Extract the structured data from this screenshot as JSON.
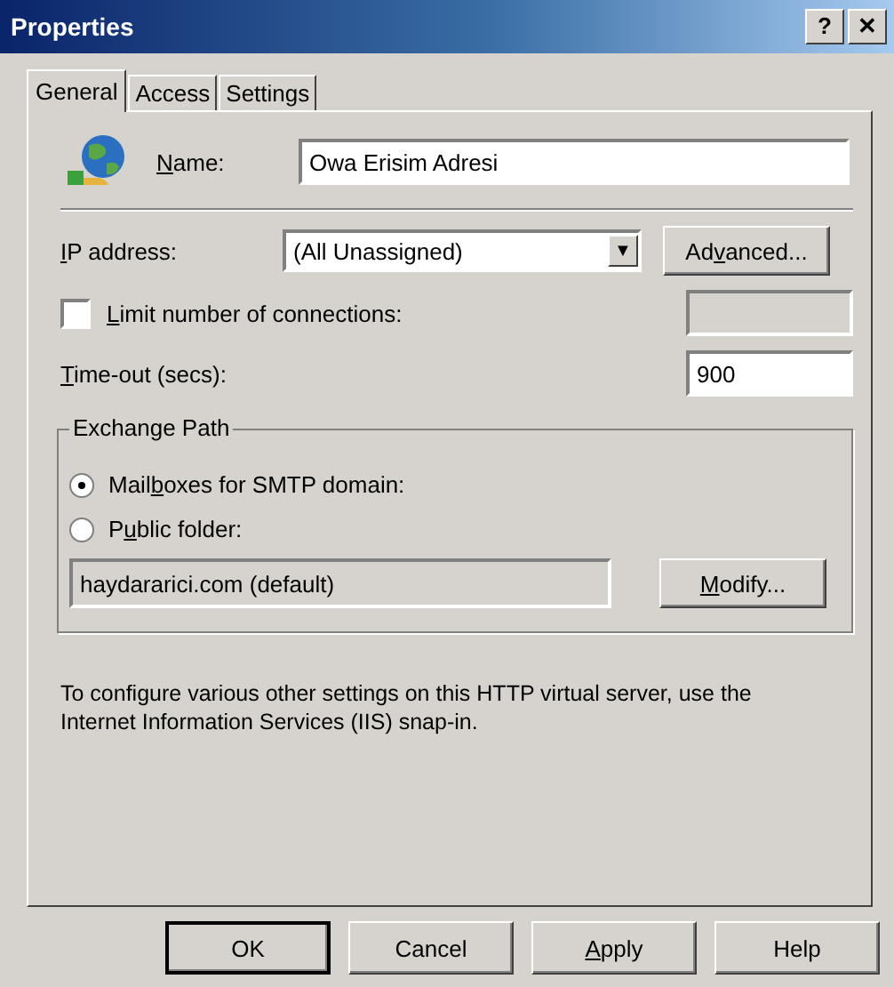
{
  "window": {
    "title": "Properties",
    "help_button": "?",
    "close_button": "✕"
  },
  "tabs": [
    {
      "label": "General",
      "selected": true
    },
    {
      "label": "Access",
      "selected": false
    },
    {
      "label": "Settings",
      "selected": false
    }
  ],
  "name_field": {
    "label": {
      "key": "N",
      "post": "ame:"
    },
    "value": "Owa Erisim Adresi"
  },
  "ip_address": {
    "label": {
      "key": "I",
      "post": "P address:"
    },
    "value": "(All Unassigned)",
    "arrow": "▼"
  },
  "advanced_button": {
    "pre": "Ad",
    "key": "v",
    "post": "anced..."
  },
  "limit_connections": {
    "label": {
      "key": "L",
      "post": "imit number of connections:"
    },
    "checked": false
  },
  "timeout": {
    "label": {
      "key": "T",
      "post": "ime-out (secs):"
    },
    "value": "900"
  },
  "exchange_path": {
    "title": "Exchange Path",
    "options": [
      {
        "label": {
          "pre": "Mail",
          "key": "b",
          "post": "oxes for SMTP domain:"
        },
        "selected": true
      },
      {
        "label": {
          "pre": "P",
          "key": "u",
          "post": "blic folder:"
        },
        "selected": false
      }
    ],
    "path_value": "haydararici.com (default)",
    "modify_button": {
      "key": "M",
      "post": "odify..."
    }
  },
  "info_text": "To configure various other settings on this HTTP virtual server, use the Internet Information Services (IIS) snap-in.",
  "buttons": [
    {
      "pre": "OK"
    },
    {
      "pre": "Cancel"
    },
    {
      "key": "A",
      "post": "pply"
    },
    {
      "pre": "Help"
    }
  ]
}
